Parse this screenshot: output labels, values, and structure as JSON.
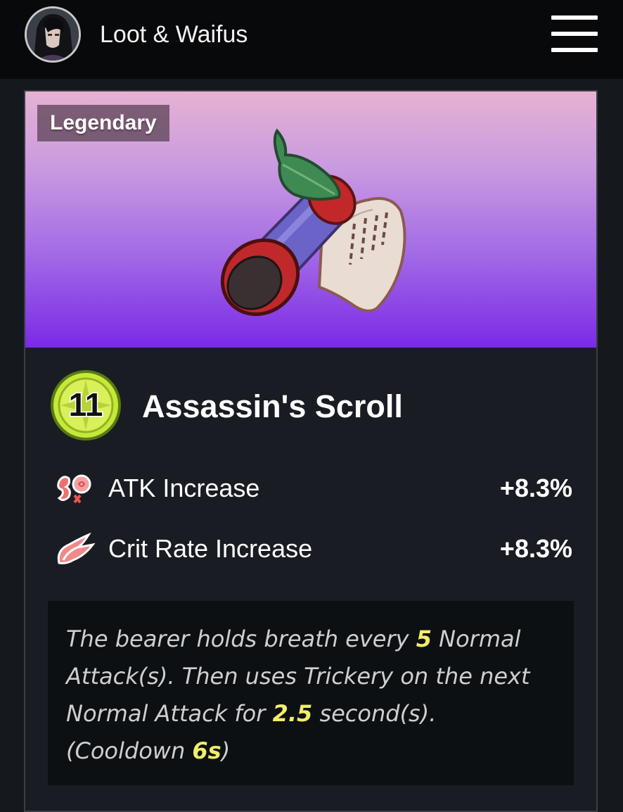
{
  "header": {
    "site_title": "Loot & Waifus",
    "avatar_icon": "user-avatar",
    "menu_icon": "hamburger-menu-icon"
  },
  "item": {
    "rarity": "Legendary",
    "level": "11",
    "name": "Assassin's Scroll",
    "image_icon": "scroll-with-leaf-icon",
    "hero_gradient": [
      "#e6b2d2",
      "#7a2ae6"
    ],
    "stats": [
      {
        "icon": "atk-icon",
        "label": "ATK Increase",
        "value": "+8.3%"
      },
      {
        "icon": "crit-rate-icon",
        "label": "Crit Rate Increase",
        "value": "+8.3%"
      }
    ],
    "description": {
      "t1": "The bearer holds breath every ",
      "h1": "5",
      "t2": " Normal Attack(s). Then uses Trickery on the next Normal Attack for ",
      "h2": "2.5",
      "t3": " second(s). (Cooldown ",
      "h3": "6s",
      "t4": ")"
    },
    "highlight_color": "#f2ec6a"
  }
}
